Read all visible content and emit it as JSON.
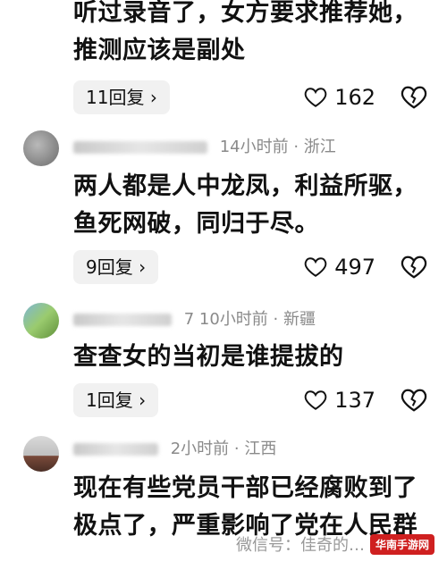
{
  "comment0": {
    "text": "听过录音了，女方要求推荐她，推测应该是副处",
    "replies": "11回复",
    "likes": "162"
  },
  "comment1": {
    "meta": "14小时前 · 浙江",
    "text": "两人都是人中龙凤，利益所驱，鱼死网破，同归于尽。",
    "replies": "9回复",
    "likes": "497"
  },
  "comment2": {
    "meta": "7  10小时前 · 新疆",
    "text": "查查女的当初是谁提拔的",
    "replies": "1回复",
    "likes": "137"
  },
  "comment3": {
    "meta": "2小时前 · 江西",
    "text": "现在有些党员干部已经腐败到了极点了，严重影响了党在人民群"
  },
  "watermark": {
    "text": "微信号：佳奇的…",
    "badge": "华南手游网"
  },
  "icons": {
    "like": "heart-icon",
    "dislike": "broken-heart-icon",
    "reply_chevron": "chevron-right-icon"
  }
}
